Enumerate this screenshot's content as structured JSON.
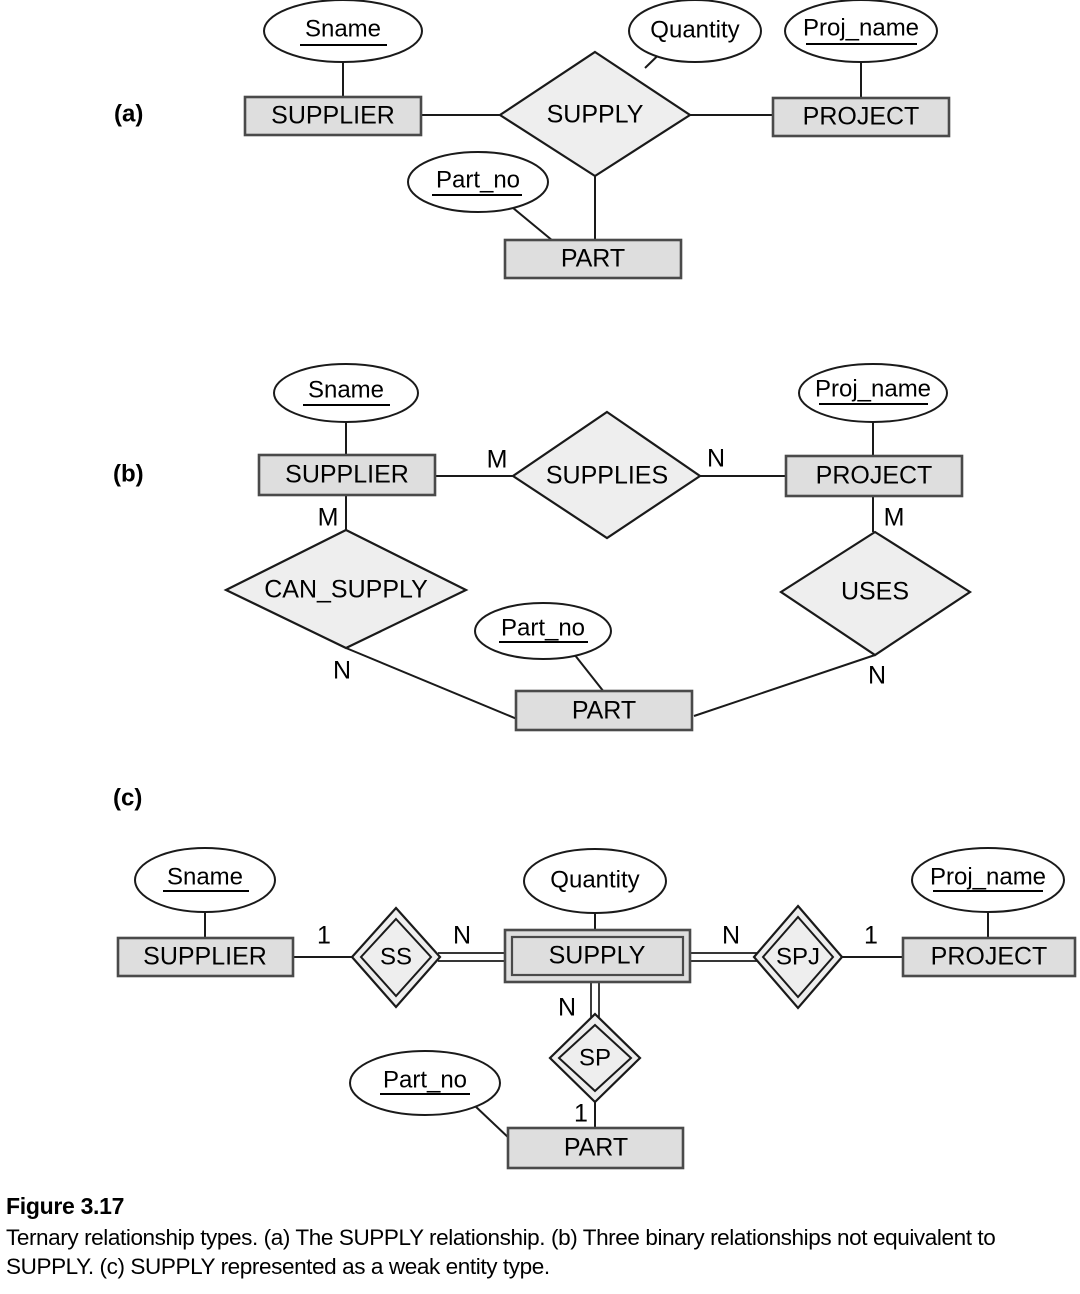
{
  "figure": {
    "number_label": "Figure 3.17",
    "caption": "Ternary relationship types. (a) The SUPPLY relationship. (b) Three binary relationships not equivalent to SUPPLY. (c) SUPPLY represented as a weak entity type.",
    "colors": {
      "entity_fill": "#dedede",
      "relationship_fill": "#eeeeee",
      "attribute_fill": "#ffffff",
      "line": "#1a1a1a",
      "entity_border": "#4a4a4a",
      "background": "#ffffff"
    }
  },
  "parts": {
    "a": {
      "label": "(a)",
      "entities": [
        {
          "name": "SUPPLIER"
        },
        {
          "name": "PROJECT"
        },
        {
          "name": "PART"
        }
      ],
      "relationships": [
        {
          "name": "SUPPLY",
          "degree": "ternary",
          "shape": "diamond"
        }
      ],
      "attributes": [
        {
          "name": "Sname",
          "key": true,
          "owner": "SUPPLIER"
        },
        {
          "name": "Proj_name",
          "key": true,
          "owner": "PROJECT"
        },
        {
          "name": "Part_no",
          "key": true,
          "owner": "PART"
        },
        {
          "name": "Quantity",
          "key": false,
          "owner": "SUPPLY"
        }
      ],
      "cardinalities": []
    },
    "b": {
      "label": "(b)",
      "entities": [
        {
          "name": "SUPPLIER"
        },
        {
          "name": "PROJECT"
        },
        {
          "name": "PART"
        }
      ],
      "relationships": [
        {
          "name": "SUPPLIES",
          "shape": "diamond"
        },
        {
          "name": "CAN_SUPPLY",
          "shape": "diamond"
        },
        {
          "name": "USES",
          "shape": "diamond"
        }
      ],
      "attributes": [
        {
          "name": "Sname",
          "key": true,
          "owner": "SUPPLIER"
        },
        {
          "name": "Proj_name",
          "key": true,
          "owner": "PROJECT"
        },
        {
          "name": "Part_no",
          "key": true,
          "owner": "PART"
        }
      ],
      "cardinalities": [
        {
          "id": "supplier_supplies",
          "value": "M"
        },
        {
          "id": "supplies_project",
          "value": "N"
        },
        {
          "id": "supplier_cansupply",
          "value": "M"
        },
        {
          "id": "cansupply_part",
          "value": "N"
        },
        {
          "id": "project_uses",
          "value": "M"
        },
        {
          "id": "uses_part",
          "value": "N"
        }
      ]
    },
    "c": {
      "label": "(c)",
      "entities": [
        {
          "name": "SUPPLIER",
          "weak": false
        },
        {
          "name": "SUPPLY",
          "weak": true
        },
        {
          "name": "PROJECT",
          "weak": false
        },
        {
          "name": "PART",
          "weak": false
        }
      ],
      "relationships": [
        {
          "name": "SS",
          "identifying": true,
          "shape": "double-diamond"
        },
        {
          "name": "SPJ",
          "identifying": true,
          "shape": "double-diamond"
        },
        {
          "name": "SP",
          "identifying": true,
          "shape": "double-diamond"
        }
      ],
      "attributes": [
        {
          "name": "Sname",
          "key": true,
          "owner": "SUPPLIER"
        },
        {
          "name": "Quantity",
          "key": false,
          "owner": "SUPPLY"
        },
        {
          "name": "Proj_name",
          "key": true,
          "owner": "PROJECT"
        },
        {
          "name": "Part_no",
          "key": true,
          "owner": "PART"
        }
      ],
      "cardinalities": [
        {
          "id": "supplier_ss",
          "value": "1"
        },
        {
          "id": "ss_supply",
          "value": "N"
        },
        {
          "id": "supply_spj",
          "value": "N"
        },
        {
          "id": "spj_project",
          "value": "1"
        },
        {
          "id": "supply_sp",
          "value": "N"
        },
        {
          "id": "sp_part",
          "value": "1"
        }
      ]
    }
  }
}
